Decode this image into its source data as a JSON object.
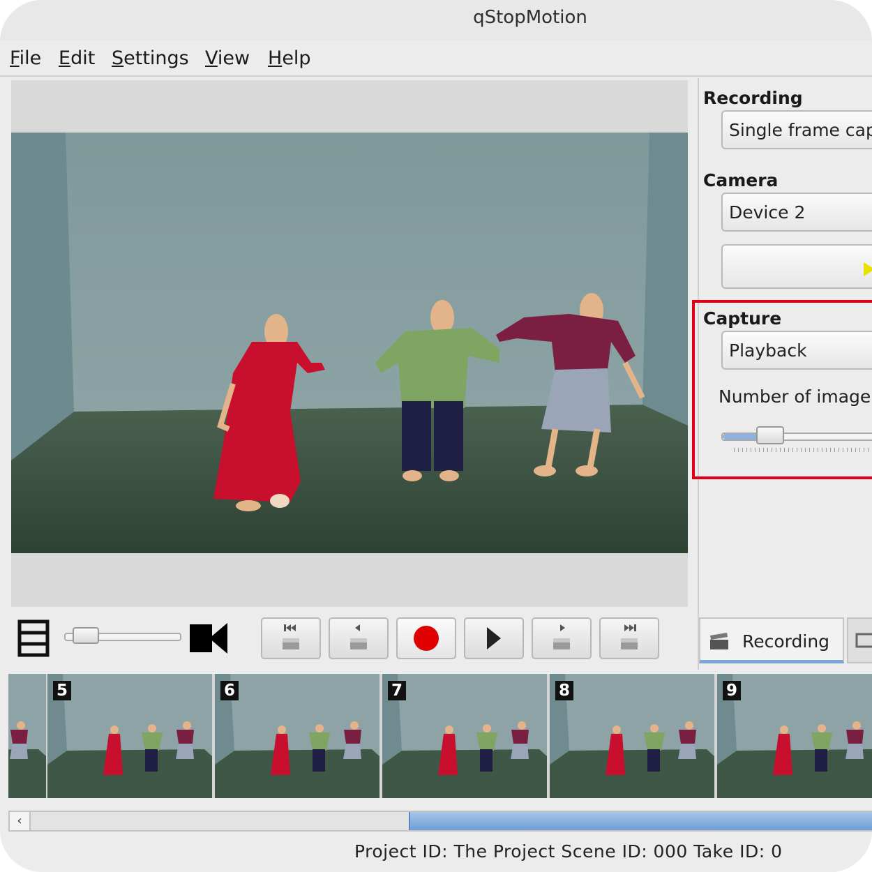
{
  "window": {
    "title": "qStopMotion"
  },
  "menubar": {
    "items": [
      {
        "label": "File",
        "mnemonic": "F",
        "rest": "ile"
      },
      {
        "label": "Edit",
        "mnemonic": "E",
        "rest": "dit"
      },
      {
        "label": "Settings",
        "mnemonic": "S",
        "rest": "ettings"
      },
      {
        "label": "View",
        "mnemonic": "V",
        "rest": "iew"
      },
      {
        "label": "Help",
        "mnemonic": "H",
        "rest": "elp"
      }
    ]
  },
  "right_panel": {
    "recording_group": {
      "title": "Recording",
      "mode_value": "Single frame cap"
    },
    "camera_group": {
      "title": "Camera",
      "device_value": "Device 2"
    },
    "capture_group": {
      "title": "Capture",
      "mode_value": "Playback",
      "slider_label": "Number of image",
      "slider_level": 0.25
    },
    "tabs": [
      {
        "label": "Recording"
      }
    ]
  },
  "controls": {
    "zoom_slider_level": 0.08,
    "buttons": [
      "first-frame",
      "previous-frame",
      "record",
      "play",
      "next-frame",
      "last-frame"
    ],
    "record_color": "#e00000"
  },
  "filmstrip": {
    "frames": [
      {
        "number": "5"
      },
      {
        "number": "6"
      },
      {
        "number": "7"
      },
      {
        "number": "8"
      },
      {
        "number": "9"
      }
    ]
  },
  "statusbar": {
    "text": "Project ID:  The Project  Scene ID:  000  Take ID:  0"
  },
  "colors": {
    "accent": "#7ba7d8",
    "highlight_frame": "#e0001a"
  }
}
